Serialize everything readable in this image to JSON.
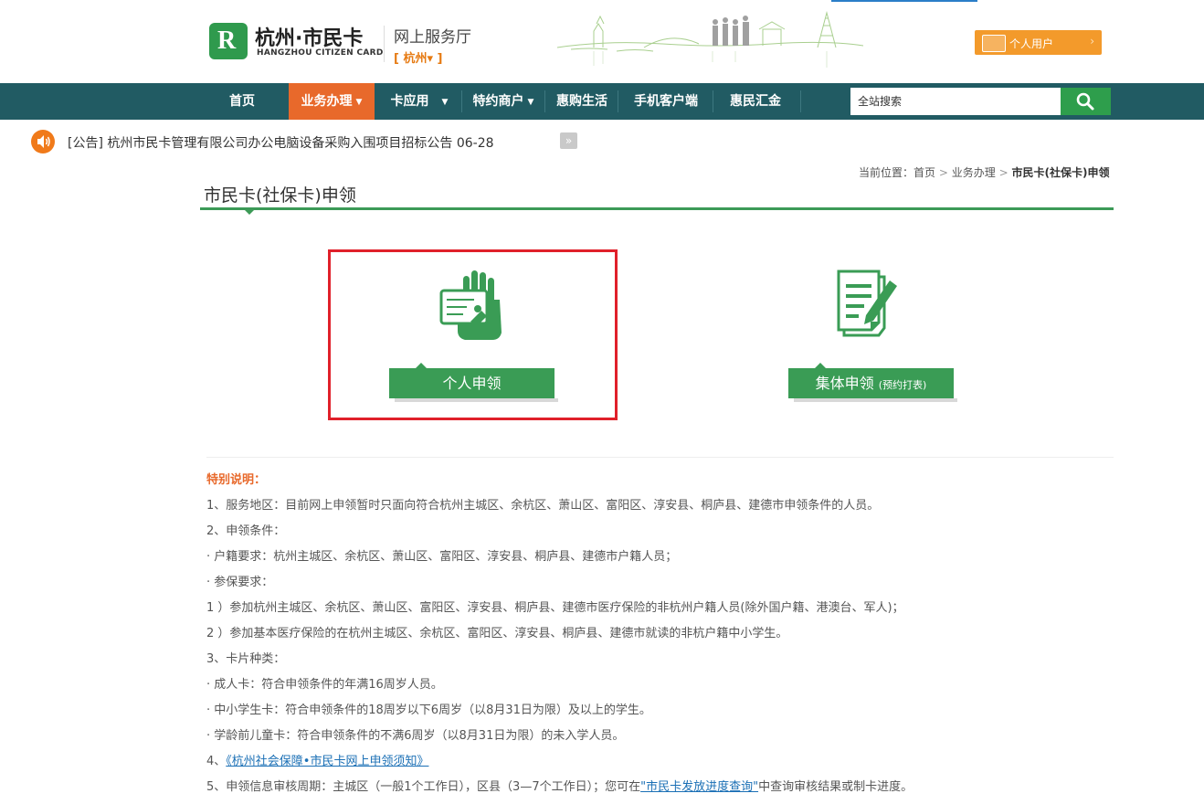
{
  "header": {
    "logo_cn": "杭州·市民卡",
    "logo_en": "HANGZHOU CITIZEN CARD",
    "hall": "网上服务厅",
    "city": "[ 杭州▾ ]",
    "user_button": "个人用户"
  },
  "nav": {
    "items": [
      {
        "label": "首页"
      },
      {
        "label": "业务办理"
      },
      {
        "label": "卡应用"
      },
      {
        "label": "特约商户"
      },
      {
        "label": "惠购生活"
      },
      {
        "label": "手机客户端"
      },
      {
        "label": "惠民汇金"
      }
    ],
    "search_placeholder": "全站搜索",
    "colors": {
      "bar": "#215b63",
      "active": "#e8692b",
      "search_button": "#2e9e4c"
    }
  },
  "notice": {
    "text": "[公告] 杭州市民卡管理有限公司办公电脑设备采购入围项目招标公告 06-28",
    "next": "»"
  },
  "breadcrumb": {
    "prefix": "当前位置：",
    "home": "首页",
    "section": "业务办理",
    "current": "市民卡(社保卡)申领",
    "sep": ">"
  },
  "page_title": "市民卡(社保卡)申领",
  "cards": {
    "personal": {
      "label": "个人申领",
      "icon": "card-hand-icon"
    },
    "group": {
      "label": "集体申领",
      "sub": "(预约打表)",
      "icon": "document-edit-icon"
    }
  },
  "notes": {
    "heading": "特别说明：",
    "lines": [
      "1、服务地区：目前网上申领暂时只面向符合杭州主城区、余杭区、萧山区、富阳区、淳安县、桐庐县、建德市申领条件的人员。",
      "2、申领条件：",
      "  · 户籍要求：杭州主城区、余杭区、萧山区、富阳区、淳安县、桐庐县、建德市户籍人员；",
      "  · 参保要求：",
      "  1 ）参加杭州主城区、余杭区、萧山区、富阳区、淳安县、桐庐县、建德市医疗保险的非杭州户籍人员(除外国户籍、港澳台、军人)；",
      "  2 ）参加基本医疗保险的在杭州主城区、余杭区、富阳区、淳安县、桐庐县、建德市就读的非杭户籍中小学生。",
      "3、卡片种类：",
      "  · 成人卡：符合申领条件的年满16周岁人员。",
      "  · 中小学生卡：符合申领条件的18周岁以下6周岁（以8月31日为限）及以上的学生。",
      "  · 学龄前儿童卡：符合申领条件的不满6周岁（以8月31日为限）的未入学人员。"
    ],
    "line4_prefix": "4、",
    "line4_link": "《杭州社会保障•市民卡网上申领须知》",
    "line5_prefix": "5、申领信息审核周期：主城区（一般1个工作日），区县（3—7个工作日）；您可在",
    "line5_link": "\"市民卡发放进度查询\"",
    "line5_suffix": "中查询审核结果或制卡进度。"
  }
}
